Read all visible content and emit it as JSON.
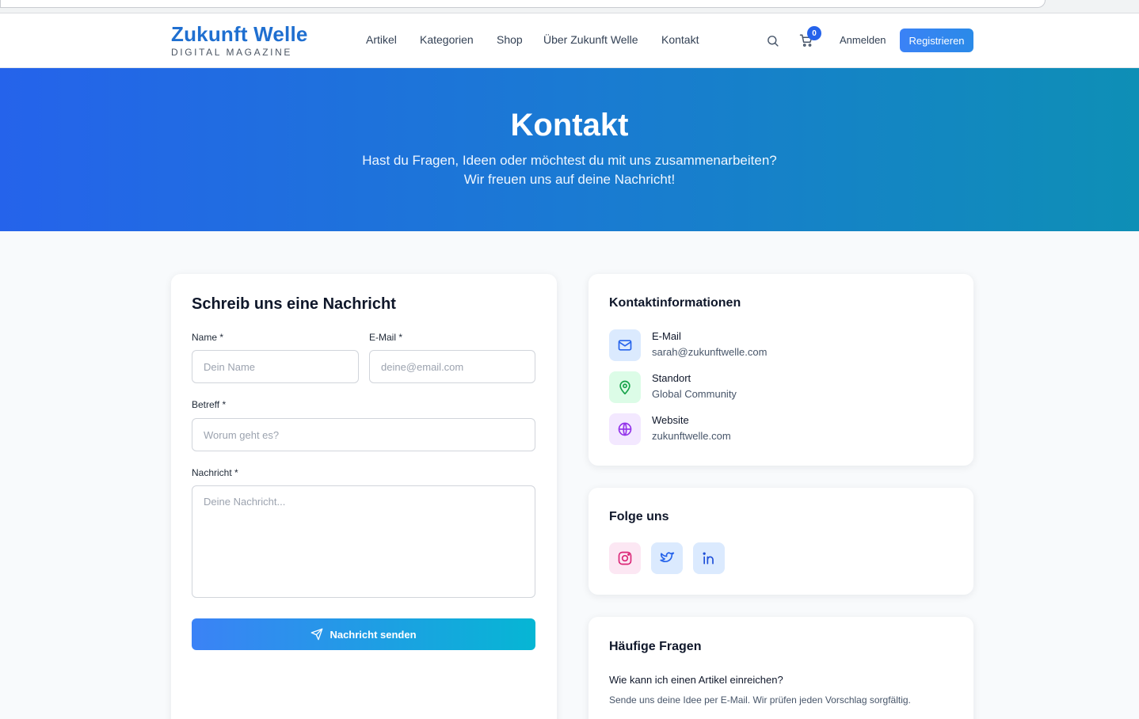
{
  "brand": {
    "title": "Zukunft Welle",
    "subtitle": "DIGITAL MAGAZINE"
  },
  "nav": {
    "items": [
      {
        "label": "Artikel"
      },
      {
        "label": "Kategorien"
      },
      {
        "label": "Shop"
      },
      {
        "label": "Über Zukunft Welle"
      },
      {
        "label": "Kontakt"
      }
    ],
    "cart_count": "0",
    "login_label": "Anmelden",
    "register_label": "Registrieren"
  },
  "hero": {
    "title": "Kontakt",
    "line1": "Hast du Fragen, Ideen oder möchtest du mit uns zusammenarbeiten?",
    "line2": "Wir freuen uns auf deine Nachricht!"
  },
  "form": {
    "title": "Schreib uns eine Nachricht",
    "name_label": "Name *",
    "name_placeholder": "Dein Name",
    "email_label": "E-Mail *",
    "email_placeholder": "deine@email.com",
    "subject_label": "Betreff *",
    "subject_placeholder": "Worum geht es?",
    "message_label": "Nachricht *",
    "message_placeholder": "Deine Nachricht...",
    "submit_label": "Nachricht senden"
  },
  "contact_info": {
    "title": "Kontaktinformationen",
    "items": [
      {
        "label": "E-Mail",
        "value": "sarah@zukunftwelle.com",
        "icon": "mail-icon"
      },
      {
        "label": "Standort",
        "value": "Global Community",
        "icon": "map-pin-icon"
      },
      {
        "label": "Website",
        "value": "zukunftwelle.com",
        "icon": "globe-icon"
      }
    ]
  },
  "follow": {
    "title": "Folge uns",
    "icons": [
      "instagram-icon",
      "twitter-icon",
      "linkedin-icon"
    ]
  },
  "faq": {
    "title": "Häufige Fragen",
    "items": [
      {
        "question": "Wie kann ich einen Artikel einreichen?",
        "answer": "Sende uns deine Idee per E-Mail. Wir prüfen jeden Vorschlag sorgfältig."
      }
    ]
  },
  "colors": {
    "brand": "#1f6fd0",
    "accent": "#3b82f6",
    "accent_end": "#06b6d4",
    "hero_start": "#2563eb",
    "hero_end": "#0e8fb6"
  }
}
